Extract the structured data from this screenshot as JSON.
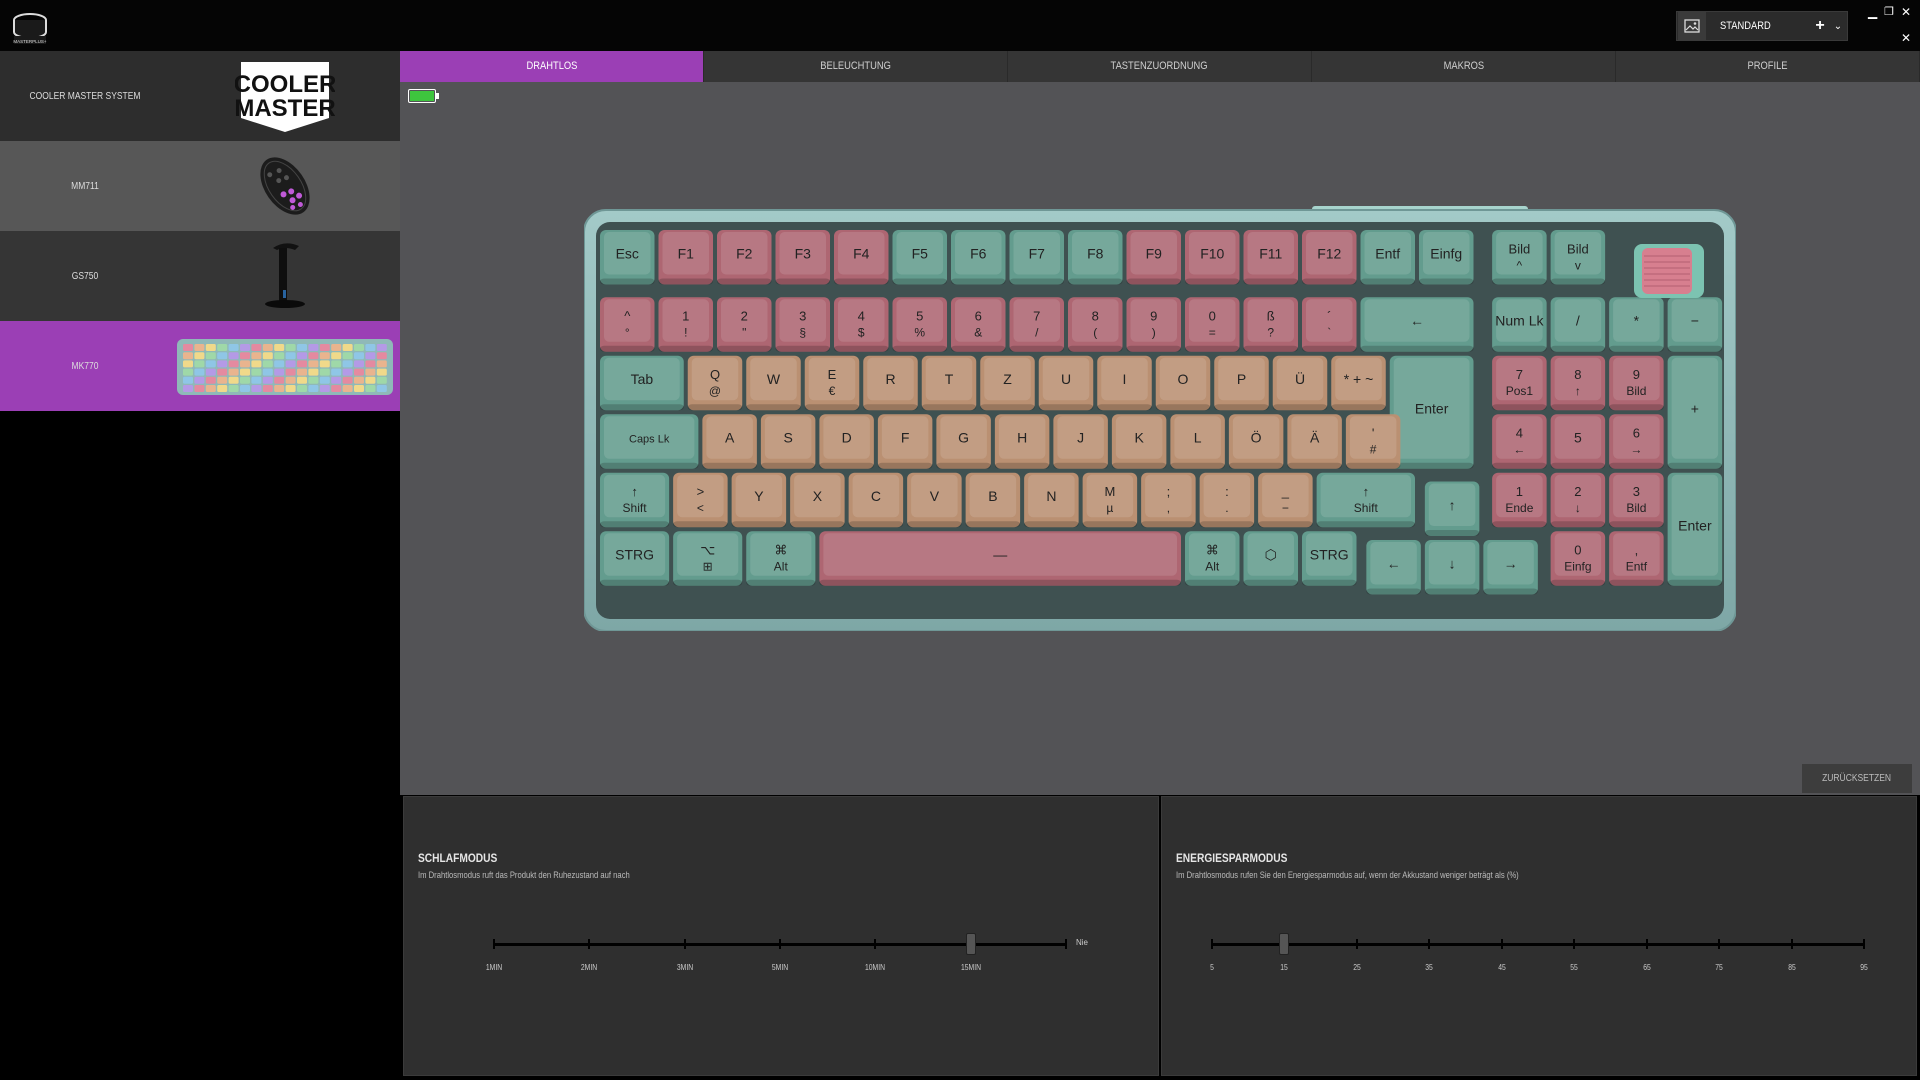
{
  "app": {
    "logo_label": "MASTERPLUS+",
    "profile": {
      "name": "STANDARD",
      "icon": "image-icon",
      "add_icon": "plus-icon",
      "dropdown_icon": "chevron-down-icon"
    }
  },
  "devices": [
    {
      "label": "COOLER MASTER SYSTEM",
      "image": "cooler-master-logo",
      "logo_line1": "COOLER",
      "logo_line2": "MASTER",
      "selected": false
    },
    {
      "label": "MM711",
      "image": "mouse-image",
      "selected": false
    },
    {
      "label": "GS750",
      "image": "headset-stand-image",
      "selected": false
    },
    {
      "label": "MK770",
      "image": "keyboard-image",
      "selected": true
    }
  ],
  "tabs": [
    {
      "label": "DRAHTLOS",
      "active": true
    },
    {
      "label": "BELEUCHTUNG",
      "active": false
    },
    {
      "label": "TASTENZUORDNUNG",
      "active": false
    },
    {
      "label": "MAKROS",
      "active": false
    },
    {
      "label": "PROFILE",
      "active": false
    }
  ],
  "battery": {
    "level": 1.0,
    "color": "#3ec53e"
  },
  "reset_button": "ZURÜCKSETZEN",
  "sleep": {
    "title": "SCHLAFMODUS",
    "description": "Im Drahtlosmodus ruft das Produkt den Ruhezustand auf nach",
    "ticks": [
      "1MIN",
      "2MIN",
      "3MIN",
      "5MIN",
      "10MIN",
      "15MIN"
    ],
    "end_label": "Nie",
    "selected": "15MIN"
  },
  "energy": {
    "title": "ENERGIESPARMODUS",
    "description": "Im Drahtlosmodus rufen Sie den Energiesparmodus auf, wenn der Akkustand weniger beträgt als (%)",
    "ticks": [
      "5",
      "15",
      "25",
      "35",
      "45",
      "55",
      "65",
      "75",
      "85",
      "95"
    ],
    "selected": "15"
  },
  "colors": {
    "accent": "#9b3fb5",
    "key_teal": "#7cc3b1",
    "key_pink": "#d9808f",
    "key_peach": "#e9b48e",
    "keyboard_case": "#8fb9b8"
  },
  "keyboard": {
    "rows": [
      [
        "Esc",
        "F1",
        "F2",
        "F3",
        "F4",
        "F5",
        "F6",
        "F7",
        "F8",
        "F9",
        "F10",
        "F11",
        "F12",
        "Entf",
        "Einfg",
        "Bild ^",
        "Bild v"
      ],
      [
        "^ °",
        "1 !",
        "2 \"",
        "3 §",
        "4 $",
        "5 %",
        "6 &",
        "7 /",
        "8 (",
        "9 )",
        "0 =",
        "ß ?",
        "´ `",
        "←",
        "Num Lk",
        "/",
        "*",
        "−"
      ],
      [
        "Tab",
        "Q @",
        "W",
        "E €",
        "R",
        "T",
        "Z",
        "U",
        "I",
        "O",
        "P",
        "Ü",
        "* + ~",
        "Enter",
        "7 Pos1",
        "8 ↑",
        "9 Bild",
        "+"
      ],
      [
        "Caps Lk",
        "A",
        "S",
        "D",
        "F",
        "G",
        "H",
        "J",
        "K",
        "L",
        "Ö",
        "Ä",
        "' #",
        "4 ←",
        "5",
        "6 →"
      ],
      [
        "↑ Shift",
        "> <",
        "Y",
        "X",
        "C",
        "V",
        "B",
        "N",
        "M µ",
        "; ,",
        ": .",
        "_ −",
        "↑ Shift",
        "↑",
        "1 Ende",
        "2 ↓",
        "3 Bild",
        "Enter"
      ],
      [
        "STRG",
        "⌥ ⊞",
        "⌘ Alt",
        "—",
        "⌘ Alt",
        "⬡",
        "STRG",
        "←",
        "↓",
        "→",
        "0 Einfg",
        ", Entf"
      ]
    ]
  }
}
